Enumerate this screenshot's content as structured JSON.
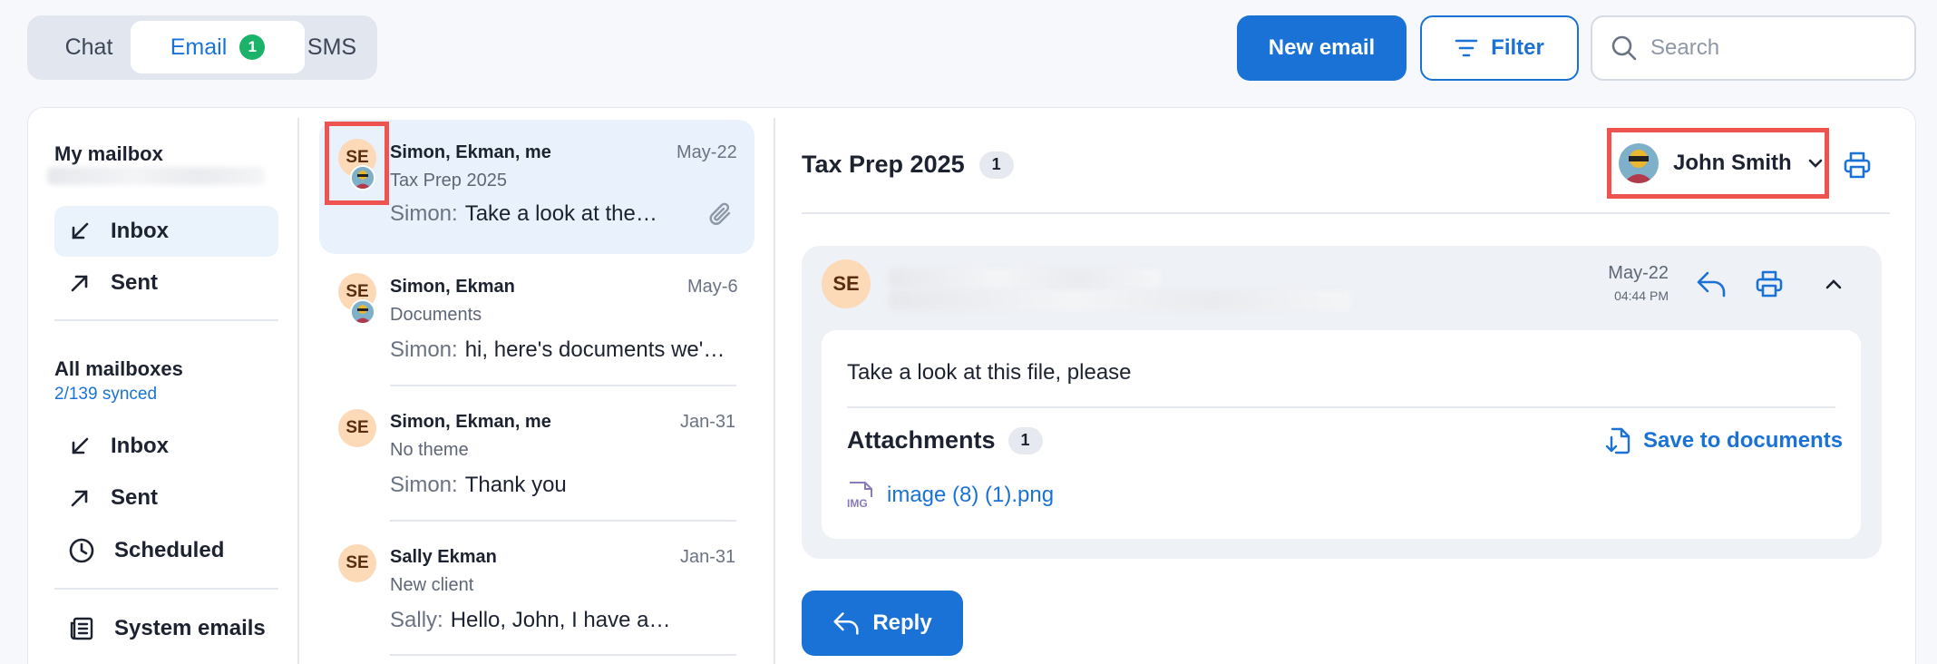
{
  "tabs": {
    "chat": "Chat",
    "email": "Email",
    "email_badge": "1",
    "sms": "SMS"
  },
  "toolbar": {
    "new_email": "New email",
    "filter": "Filter",
    "search_placeholder": "Search"
  },
  "sidebar": {
    "my_mailbox": {
      "title": "My mailbox",
      "items": [
        {
          "label": "Inbox",
          "icon": "arrow-down-left-icon",
          "active": true
        },
        {
          "label": "Sent",
          "icon": "arrow-up-right-icon",
          "active": false
        }
      ]
    },
    "all_mailboxes": {
      "title": "All mailboxes",
      "synced": "2/139 synced",
      "items": [
        {
          "label": "Inbox",
          "icon": "arrow-down-left-icon"
        },
        {
          "label": "Sent",
          "icon": "arrow-up-right-icon"
        },
        {
          "label": "Scheduled",
          "icon": "clock-icon"
        }
      ]
    },
    "system_emails": "System emails"
  },
  "emails": [
    {
      "initials": "SE",
      "sender": "Simon, Ekman, me",
      "date": "May-22",
      "subject": "Tax Prep 2025",
      "preview_who": "Simon:",
      "preview": "Take a look at the…",
      "has_attachment": true,
      "selected": true
    },
    {
      "initials": "SE",
      "sender": "Simon, Ekman",
      "date": "May-6",
      "subject": "Documents",
      "preview_who": "Simon:",
      "preview": "hi, here's documents we'…"
    },
    {
      "initials": "SE",
      "sender": "Simon, Ekman, me",
      "date": "Jan-31",
      "subject": "No theme",
      "preview_who": "Simon:",
      "preview": "Thank you"
    },
    {
      "initials": "SE",
      "sender": "Sally Ekman",
      "date": "Jan-31",
      "subject": "New client",
      "preview_who": "Sally:",
      "preview": "Hello, John, I have a…"
    }
  ],
  "thread": {
    "title": "Tax Prep 2025",
    "count": "1",
    "user": "John Smith",
    "message": {
      "initials": "SE",
      "date": "May-22",
      "time": "04:44 PM",
      "body": "Take a look at this file, please",
      "attachments_label": "Attachments",
      "attachments_count": "1",
      "save_label": "Save to documents",
      "attachment_name": "image (8) (1).png",
      "attachment_type": "IMG"
    },
    "reply_label": "Reply"
  },
  "colors": {
    "accent": "#1a72d6",
    "badge_green": "#1bb36a",
    "highlight": "#ef5350",
    "avatar_bg": "#fcd9b7"
  }
}
